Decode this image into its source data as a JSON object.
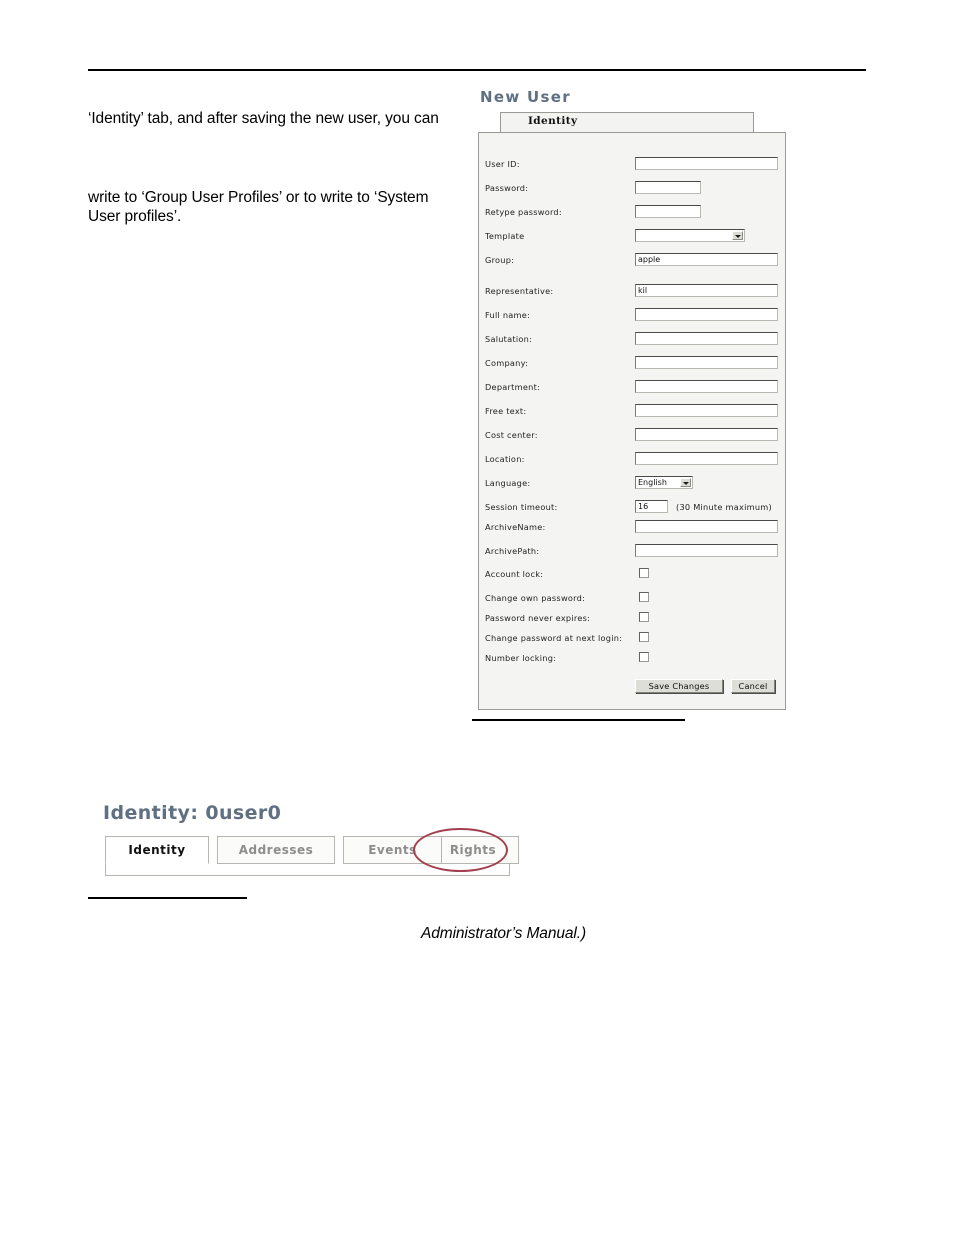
{
  "page": {
    "background_color": "#ffffff",
    "heading_color": "#5f7082",
    "annotation_color": "#a43f4d"
  },
  "body_text": {
    "paragraph_top": "‘Identity’ tab, and after saving the new user, you can",
    "paragraph_second": "write to ‘Group User Profiles’ or to write to ‘System User profiles’.",
    "caption_italic": "Administrator’s Manual.)"
  },
  "new_user_form": {
    "title": "New User",
    "tab_label": "Identity",
    "fields": [
      {
        "label": "User ID:",
        "type": "text",
        "value": ""
      },
      {
        "label": "Password:",
        "type": "text",
        "value": ""
      },
      {
        "label": "Retype password:",
        "type": "text",
        "value": ""
      },
      {
        "label": "Template",
        "type": "select",
        "value": ""
      },
      {
        "label": "Group:",
        "type": "text",
        "value": "apple"
      },
      {
        "label": "Representative:",
        "type": "text",
        "value": "kil"
      },
      {
        "label": "Full name:",
        "type": "text",
        "value": ""
      },
      {
        "label": "Salutation:",
        "type": "text",
        "value": ""
      },
      {
        "label": "Company:",
        "type": "text",
        "value": ""
      },
      {
        "label": "Department:",
        "type": "text",
        "value": ""
      },
      {
        "label": "Free text:",
        "type": "text",
        "value": ""
      },
      {
        "label": "Cost center:",
        "type": "text",
        "value": ""
      },
      {
        "label": "Location:",
        "type": "text",
        "value": ""
      },
      {
        "label": "Language:",
        "type": "select",
        "value": "English"
      },
      {
        "label": "Session timeout:",
        "type": "text",
        "value": "16",
        "hint": "(30 Minute maximum)"
      },
      {
        "label": "ArchiveName:",
        "type": "text",
        "value": ""
      },
      {
        "label": "ArchivePath:",
        "type": "text",
        "value": ""
      },
      {
        "label": "Account lock:",
        "type": "checkbox",
        "checked": false
      },
      {
        "label": "Change own password:",
        "type": "checkbox",
        "checked": false
      },
      {
        "label": "Password never expires:",
        "type": "checkbox",
        "checked": false
      },
      {
        "label": "Change password at next login:",
        "type": "checkbox",
        "checked": false
      },
      {
        "label": "Number locking:",
        "type": "checkbox",
        "checked": false
      }
    ],
    "buttons": {
      "save": "Save Changes",
      "cancel": "Cancel"
    }
  },
  "identity_figure": {
    "heading": "Identity: 0user0",
    "tabs": [
      {
        "label": "Identity",
        "active": true
      },
      {
        "label": "Addresses",
        "active": false
      },
      {
        "label": "Events",
        "active": false
      },
      {
        "label": "Rights",
        "active": false,
        "annotated": true
      }
    ]
  }
}
